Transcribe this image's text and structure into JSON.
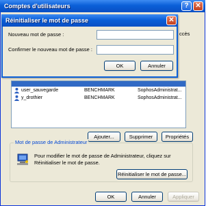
{
  "window": {
    "title": "Comptes d'utilisateurs",
    "help_label": "?",
    "close_label": "✕"
  },
  "partial_text": "ccès",
  "users": [
    {
      "name": "user_sauvegarde",
      "domain": "BENCHMARK",
      "group": "SophosAdministrat..."
    },
    {
      "name": "y_drothier",
      "domain": "BENCHMARK",
      "group": "SophosAdministrat..."
    }
  ],
  "buttons": {
    "add": "Ajouter...",
    "remove": "Supprimer",
    "properties": "Propriétés"
  },
  "admin_group": {
    "label": "Mot de passe de Administrateur",
    "info": "Pour modifier le mot de passe de Administrateur, cliquez sur Réinitialiser le mot de passe.",
    "reset_button": "Réinitialiser le mot de passe..."
  },
  "footer": {
    "ok": "OK",
    "cancel": "Annuler",
    "apply": "Appliquer"
  },
  "dialog": {
    "title": "Réinitialiser le mot de passe",
    "close_label": "✕",
    "new_password_label": "Nouveau mot de passe :",
    "new_password_value": "",
    "confirm_password_label": "Confirmer le nouveau mot de passe :",
    "confirm_password_value": "",
    "ok": "OK",
    "cancel": "Annuler"
  }
}
